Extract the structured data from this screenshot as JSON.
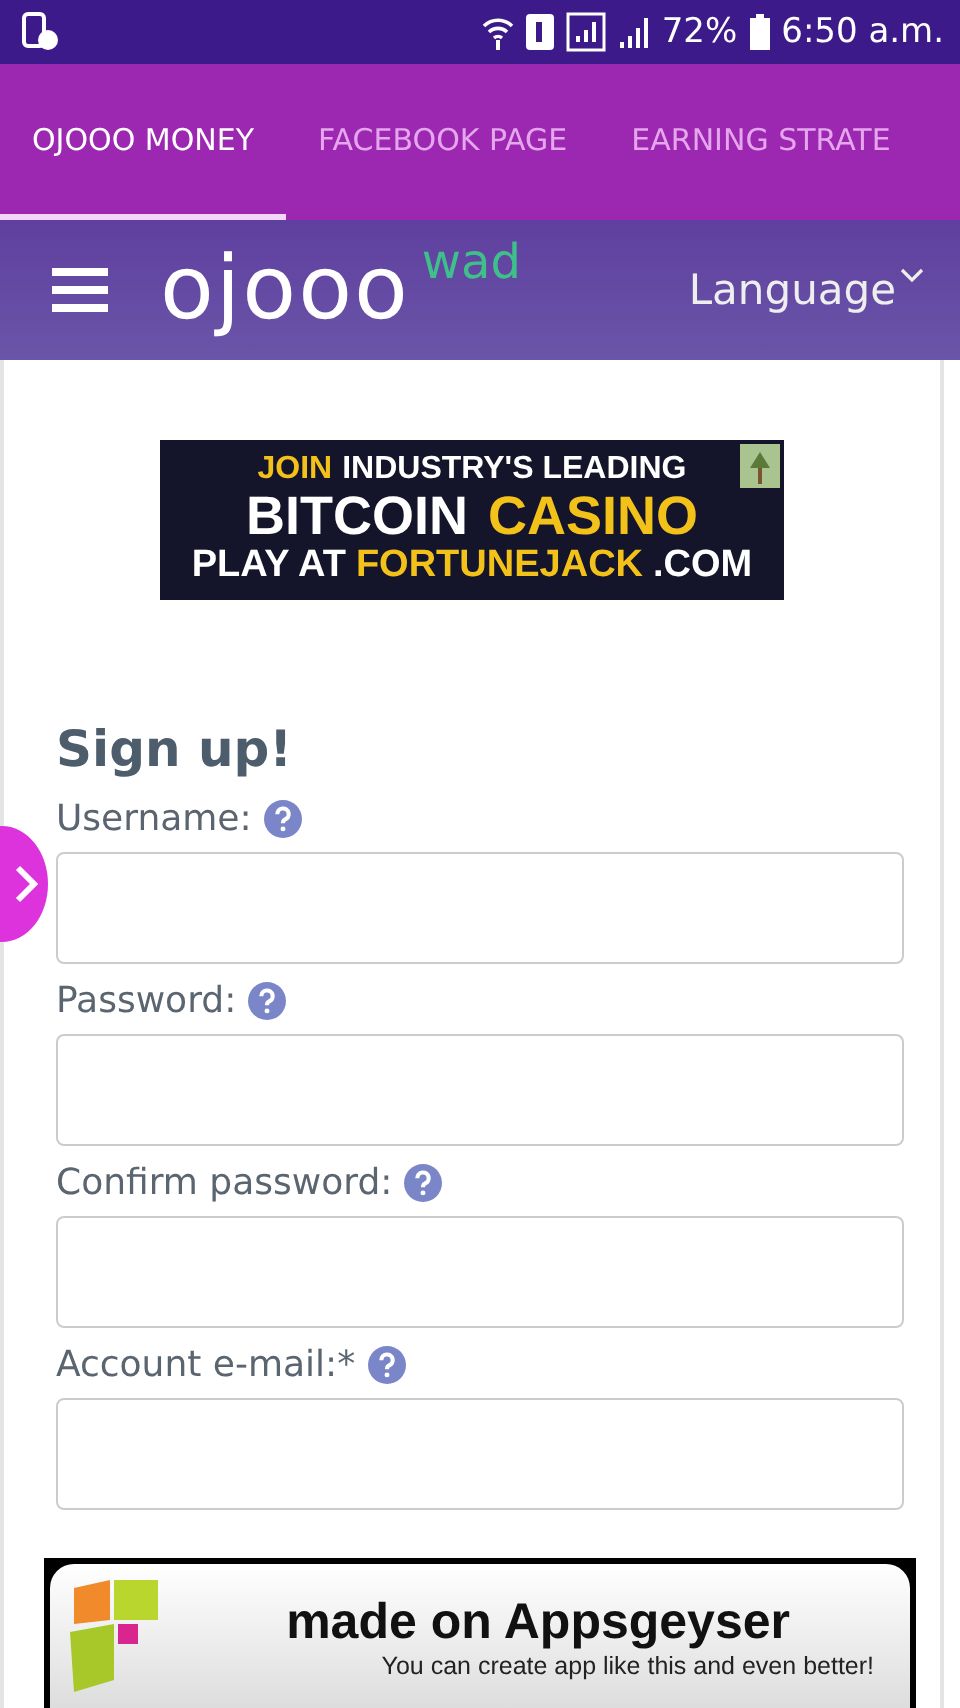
{
  "status_bar": {
    "battery": "72%",
    "time": "6:50 a.m."
  },
  "tabs": [
    {
      "label": "OJOOO MONEY",
      "selected": true
    },
    {
      "label": "FACEBOOK PAGE",
      "selected": false
    },
    {
      "label": "EARNING STRATE",
      "selected": false
    }
  ],
  "header": {
    "logo": "ojooo",
    "logo_suffix": "wad",
    "language": "Language"
  },
  "ad": {
    "lines": [
      [
        {
          "text": "JOIN",
          "highlight": true
        },
        {
          "text": "INDUSTRY'S LEADING",
          "highlight": false
        }
      ],
      [
        {
          "text": "BITCOIN",
          "highlight": false
        },
        {
          "text": "CASINO",
          "highlight": true
        }
      ],
      [
        {
          "text": "PLAY AT",
          "highlight": false
        },
        {
          "text": "FORTUNEJACK",
          "highlight": true
        },
        {
          "text": ".COM",
          "highlight": false
        }
      ]
    ]
  },
  "form": {
    "title": "Sign up!",
    "fields": [
      {
        "label": "Username:"
      },
      {
        "label": "Password:"
      },
      {
        "label": "Confirm password:"
      },
      {
        "label": "Account e-mail:*"
      }
    ]
  },
  "footer_banner": {
    "title": "made on Appsgeyser",
    "subtitle": "You can create app like this and even better!"
  }
}
